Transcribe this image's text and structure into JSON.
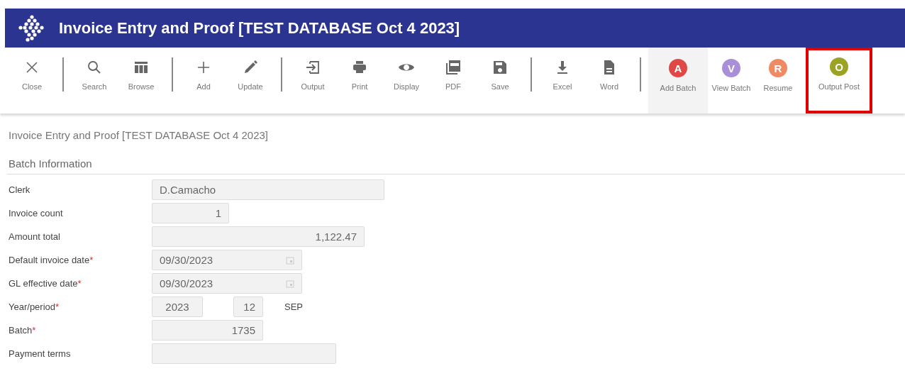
{
  "window": {
    "title": "Invoice Entry and Proof [TEST DATABASE Oct 4 2023]"
  },
  "toolbar": {
    "groups": [
      [
        {
          "kind": "icon",
          "label": "Close",
          "active": false,
          "highlighted": false
        }
      ],
      [
        {
          "kind": "icon",
          "label": "Search",
          "active": false,
          "highlighted": false
        },
        {
          "kind": "icon",
          "label": "Browse",
          "active": false,
          "highlighted": false
        }
      ],
      [
        {
          "kind": "icon",
          "label": "Add",
          "active": false,
          "highlighted": false
        },
        {
          "kind": "icon",
          "label": "Update",
          "active": false,
          "highlighted": false
        }
      ],
      [
        {
          "kind": "icon",
          "label": "Output",
          "active": false,
          "highlighted": false
        },
        {
          "kind": "icon",
          "label": "Print",
          "active": false,
          "highlighted": false
        },
        {
          "kind": "icon",
          "label": "Display",
          "active": false,
          "highlighted": false
        },
        {
          "kind": "icon",
          "label": "PDF",
          "active": false,
          "highlighted": false
        },
        {
          "kind": "icon",
          "label": "Save",
          "active": false,
          "highlighted": false
        }
      ],
      [
        {
          "kind": "icon",
          "label": "Excel",
          "active": false,
          "highlighted": false
        },
        {
          "kind": "icon",
          "label": "Word",
          "active": false,
          "highlighted": false
        }
      ],
      [
        {
          "kind": "letter",
          "letter": "A",
          "color": "#e04848",
          "label": "Add Batch",
          "active": true,
          "highlighted": false
        },
        {
          "kind": "letter",
          "letter": "V",
          "color": "#a98fd8",
          "label": "View Batch",
          "active": false,
          "highlighted": false
        },
        {
          "kind": "letter",
          "letter": "R",
          "color": "#f08a62",
          "label": "Resume",
          "active": false,
          "highlighted": false
        },
        {
          "kind": "letter",
          "letter": "O",
          "color": "#9aa324",
          "label": "Output Post",
          "active": false,
          "highlighted": true
        }
      ]
    ]
  },
  "page_title": "Invoice Entry and Proof [TEST DATABASE Oct 4 2023]",
  "section": {
    "title": "Batch Information",
    "fields": [
      {
        "kind": "text",
        "label": "Clerk",
        "value": "D.Camacho"
      },
      {
        "kind": "text",
        "label": "Invoice count",
        "value": "1"
      },
      {
        "kind": "text",
        "label": "Amount total",
        "value": "1,122.47"
      },
      {
        "kind": "date",
        "label": "Default invoice date",
        "mark": "*",
        "value": "09/30/2023"
      },
      {
        "kind": "date",
        "label": "GL effective date",
        "mark": "*",
        "value": "09/30/2023"
      },
      {
        "kind": "pair",
        "label": "Year/period",
        "mark": "*",
        "values": [
          "2023",
          "12"
        ],
        "suffix": "SEP"
      },
      {
        "kind": "text",
        "label": "Batch",
        "mark": "*",
        "value": "1735"
      },
      {
        "kind": "empty",
        "label": "Payment terms"
      }
    ]
  }
}
